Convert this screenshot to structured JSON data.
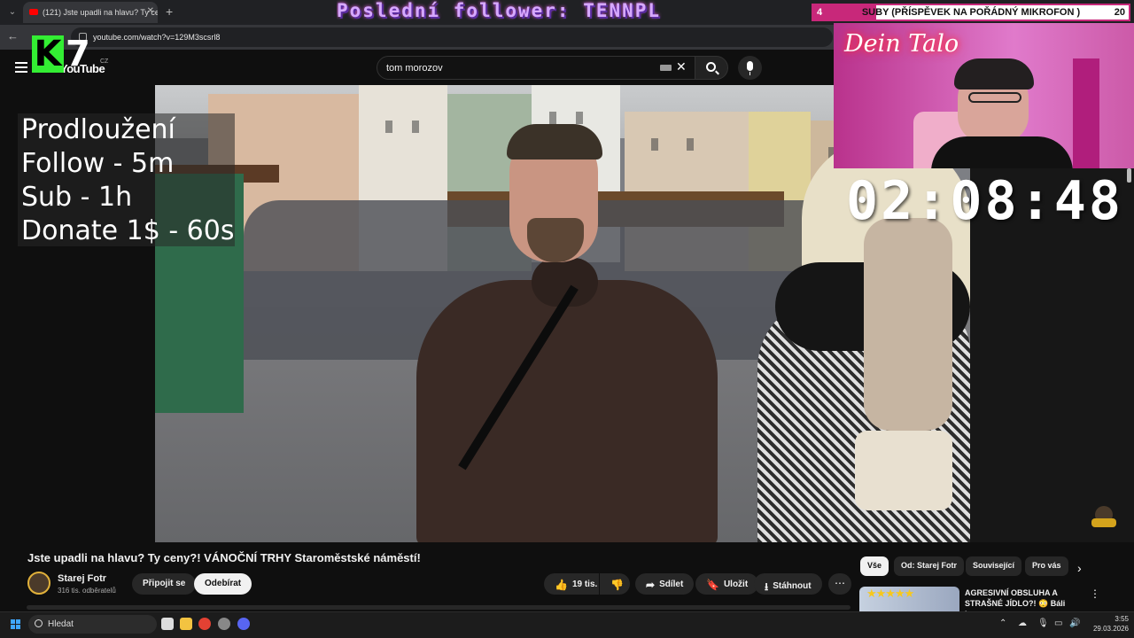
{
  "browser": {
    "tab_title": "(121) Jste upadli na hlavu? Ty ce",
    "url": "youtube.com/watch?v=129M3scsrl8"
  },
  "overlay": {
    "follower_banner": "Poslední follower: TENNPL",
    "goal": {
      "current": "4",
      "label": "SUBY (PŘÍSPĚVEK NA POŘÁDNÝ MIKROFON )",
      "target": "20",
      "progress_fraction": 0.2
    },
    "extension_lines": [
      "Prodloužení",
      "Follow - 5m",
      "Sub - 1h",
      "Donate 1$ - 60s"
    ],
    "timer": "02:08:48",
    "webcam_sign": "Dein Talo",
    "logo_text": "7",
    "logo_k": "K"
  },
  "youtube": {
    "logo": "YouTube",
    "region": "CZ",
    "search_value": "tom morozov"
  },
  "video": {
    "title": "Jste upadli na hlavu? Ty ceny?! VÁNOČNÍ TRHY Staroměstské náměstí!",
    "channel": "Starej Fotr",
    "subscribers": "316 tis. odběratelů",
    "join_label": "Připojit se",
    "subscribe_label": "Odebírat",
    "likes": "19 tis.",
    "share_label": "Sdílet",
    "save_label": "Uložit",
    "download_label": "Stáhnout"
  },
  "chips": [
    "Vše",
    "Od: Starej Fotr",
    "Související",
    "Pro vás"
  ],
  "recommendation": {
    "title": "AGRESIVNÍ OBSLUHA A STRAŠNÉ JÍDLO?! 😳 Báli jsm...",
    "stars": "★★★★★"
  },
  "taskbar": {
    "search_placeholder": "Hledat",
    "time": "3:55",
    "date": "29.03.2026"
  }
}
